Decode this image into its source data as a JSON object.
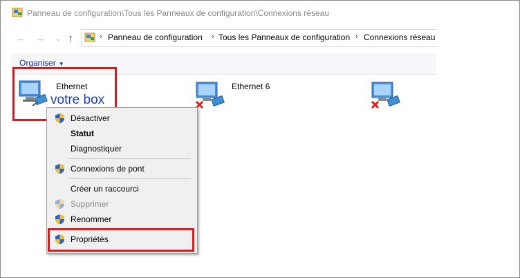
{
  "window": {
    "title": "Panneau de configuration\\Tous les Panneaux de configuration\\Connexions réseau"
  },
  "nav": {
    "back": "←",
    "forward": "→",
    "recent": "⌄",
    "up": "↑"
  },
  "address": {
    "crumbs": [
      "Panneau de configuration",
      "Tous les Panneaux de configuration",
      "Connexions réseau"
    ],
    "separator": "›"
  },
  "toolbar": {
    "organiser_label": "Organiser",
    "caret": "▼"
  },
  "connections": [
    {
      "label": "Ethernet",
      "disconnected": false
    },
    {
      "label": "Ethernet 6",
      "disconnected": true
    },
    {
      "label": "",
      "disconnected": true
    }
  ],
  "annotation": {
    "text": "votre box",
    "color": "#1c3fb8",
    "highlight_color": "#d91a1a"
  },
  "context_menu": {
    "items": [
      {
        "label": "Désactiver",
        "shield": true,
        "bold": false,
        "disabled": false
      },
      {
        "label": "Statut",
        "shield": false,
        "bold": true,
        "disabled": false
      },
      {
        "label": "Diagnostiquer",
        "shield": false,
        "bold": false,
        "disabled": false
      },
      {
        "label": "Connexions de pont",
        "shield": true,
        "bold": false,
        "disabled": false
      },
      {
        "label": "Créer un raccourci",
        "shield": false,
        "bold": false,
        "disabled": false
      },
      {
        "label": "Supprimer",
        "shield": true,
        "bold": false,
        "disabled": true
      },
      {
        "label": "Renommer",
        "shield": true,
        "bold": false,
        "disabled": false
      },
      {
        "label": "Propriétés",
        "shield": true,
        "bold": false,
        "disabled": false
      }
    ]
  }
}
